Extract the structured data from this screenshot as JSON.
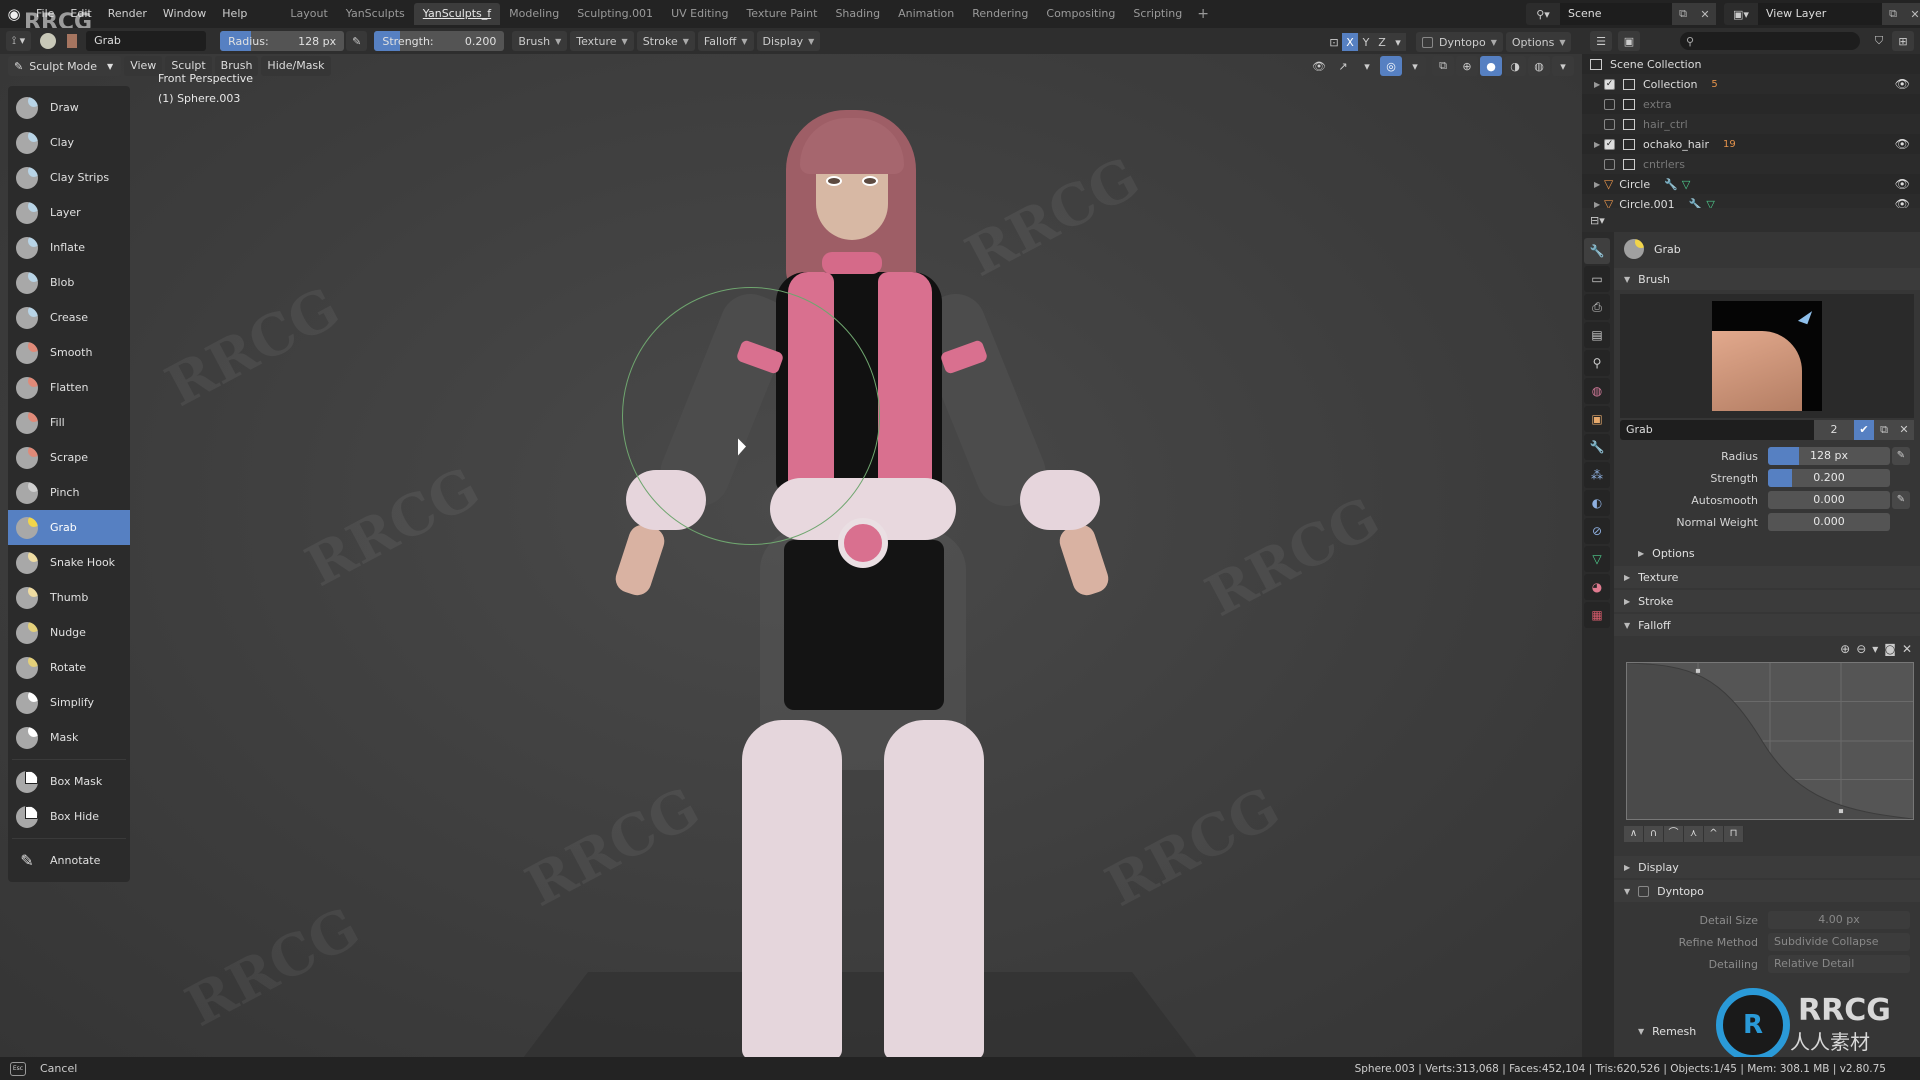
{
  "topbar": {
    "menus": [
      "File",
      "Edit",
      "Render",
      "Window",
      "Help"
    ],
    "workspaces": [
      "Layout",
      "YanSculpts",
      "YanSculpts_f",
      "Modeling",
      "Sculpting.001",
      "UV Editing",
      "Texture Paint",
      "Shading",
      "Animation",
      "Rendering",
      "Compositing",
      "Scripting"
    ],
    "active_workspace": "YanSculpts_f",
    "add_workspace": "+",
    "scene": "Scene",
    "view_layer": "View Layer"
  },
  "toolheader": {
    "brush_name": "Grab",
    "radius_label": "Radius:",
    "radius_value": "128 px",
    "radius_fraction": 0.25,
    "strength_label": "Strength:",
    "strength_value": "0.200",
    "strength_fraction": 0.2,
    "dropdowns": [
      "Brush",
      "Texture",
      "Stroke",
      "Falloff",
      "Display"
    ],
    "axes": [
      "X",
      "Y",
      "Z"
    ],
    "active_axis": "X",
    "dyntopo": "Dyntopo",
    "options": "Options"
  },
  "viewport": {
    "mode": "Sculpt Mode",
    "menus": [
      "View",
      "Sculpt",
      "Brush",
      "Hide/Mask"
    ],
    "view_name": "Front Perspective",
    "object_name": "(1) Sphere.003"
  },
  "tools": [
    {
      "label": "Draw",
      "icon": "draw-icon",
      "accent": "#b8d4e6"
    },
    {
      "label": "Clay",
      "icon": "clay-icon",
      "accent": "#b8d4e6"
    },
    {
      "label": "Clay Strips",
      "icon": "clay-strips-icon",
      "accent": "#b8d4e6"
    },
    {
      "label": "Layer",
      "icon": "layer-icon",
      "accent": "#b8d4e6"
    },
    {
      "label": "Inflate",
      "icon": "inflate-icon",
      "accent": "#b8d4e6"
    },
    {
      "label": "Blob",
      "icon": "blob-icon",
      "accent": "#b8d4e6"
    },
    {
      "label": "Crease",
      "icon": "crease-icon",
      "accent": "#b8d4e6"
    },
    {
      "label": "Smooth",
      "icon": "smooth-icon",
      "accent": "#e08a78"
    },
    {
      "label": "Flatten",
      "icon": "flatten-icon",
      "accent": "#e08a78"
    },
    {
      "label": "Fill",
      "icon": "fill-icon",
      "accent": "#e08a78"
    },
    {
      "label": "Scrape",
      "icon": "scrape-icon",
      "accent": "#e08a78"
    },
    {
      "label": "Pinch",
      "icon": "pinch-icon",
      "accent": "#cfcfcf"
    },
    {
      "label": "Grab",
      "icon": "grab-icon",
      "accent": "#f2d54a",
      "active": true
    },
    {
      "label": "Snake Hook",
      "icon": "snake-hook-icon",
      "accent": "#efdca2"
    },
    {
      "label": "Thumb",
      "icon": "thumb-icon",
      "accent": "#efdca2"
    },
    {
      "label": "Nudge",
      "icon": "nudge-icon",
      "accent": "#e4d07a"
    },
    {
      "label": "Rotate",
      "icon": "rotate-icon",
      "accent": "#e4d07a"
    },
    {
      "label": "Simplify",
      "icon": "simplify-icon",
      "accent": "#ffffff"
    },
    {
      "label": "Mask",
      "icon": "mask-icon",
      "accent": "#ffffff"
    }
  ],
  "tools_extra": [
    {
      "label": "Box Mask",
      "icon": "box-mask-icon"
    },
    {
      "label": "Box Hide",
      "icon": "box-hide-icon"
    },
    {
      "label": "Annotate",
      "icon": "annotate-icon"
    }
  ],
  "outliner": {
    "root": "Scene Collection",
    "rows": [
      {
        "label": "Collection",
        "checked": true,
        "badge": "5",
        "visible": true
      },
      {
        "label": "extra",
        "checked": false
      },
      {
        "label": "hair_ctrl",
        "checked": false
      },
      {
        "label": "ochako_hair",
        "checked": true,
        "badge": "19",
        "visible": true
      },
      {
        "label": "cntrlers",
        "checked": false
      },
      {
        "label": "Circle",
        "object": true,
        "visible": true
      },
      {
        "label": "Circle.001",
        "object": true,
        "visible": true
      }
    ]
  },
  "properties": {
    "active_tool": "Grab",
    "brush_panel": "Brush",
    "brush_datablock": "Grab",
    "brush_users": "2",
    "fields": [
      {
        "label": "Radius",
        "value": "128 px",
        "fraction": 0.25,
        "pen": true
      },
      {
        "label": "Strength",
        "value": "0.200",
        "fraction": 0.2
      },
      {
        "label": "Autosmooth",
        "value": "0.000",
        "pen": true
      },
      {
        "label": "Normal Weight",
        "value": "0.000"
      }
    ],
    "options": "Options",
    "texture": "Texture",
    "stroke": "Stroke",
    "falloff": "Falloff",
    "display": "Display",
    "dyntopo": "Dyntopo",
    "detail_size_label": "Detail Size",
    "detail_size": "4.00 px",
    "refine_label": "Refine Method",
    "refine": "Subdivide Collapse",
    "detailing_label": "Detailing",
    "detailing": "Relative Detail",
    "remesh": "Remesh"
  },
  "statusbar": {
    "left": "Cancel",
    "esc": "Esc",
    "right": "Sphere.003 | Verts:313,068 | Faces:452,104 | Tris:620,526 | Objects:1/45 | Mem: 308.1 MB | v2.80.75"
  },
  "watermark": {
    "brand": "RRCG",
    "sub": "人人素材"
  }
}
